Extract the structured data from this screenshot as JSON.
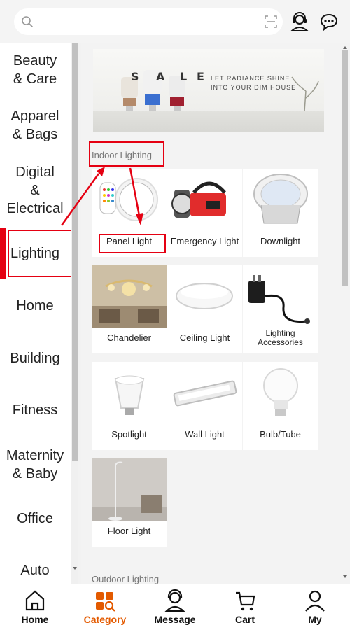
{
  "search": {
    "value": "",
    "placeholder": ""
  },
  "sidebar": {
    "items": [
      {
        "label": "Beauty\n& Care"
      },
      {
        "label": "Apparel\n& Bags"
      },
      {
        "label": "Digital\n&\nElectrical"
      },
      {
        "label": "Lighting"
      },
      {
        "label": "Home"
      },
      {
        "label": "Building"
      },
      {
        "label": "Fitness"
      },
      {
        "label": "Maternity\n& Baby"
      },
      {
        "label": "Office"
      },
      {
        "label": "Auto"
      }
    ],
    "active_index": 3
  },
  "banner": {
    "sale_letters": [
      "S",
      "A",
      "L",
      "E"
    ],
    "tagline": "LET RADIANCE SHINE INTO YOUR DIM HOUSE"
  },
  "sections": {
    "indoor_title": "Indoor Lighting",
    "outdoor_title": "Outdoor Lighting"
  },
  "products": [
    {
      "label": "Panel Light",
      "icon": "panel-light"
    },
    {
      "label": "Emergency Light",
      "icon": "emergency-light"
    },
    {
      "label": "Downlight",
      "icon": "downlight"
    },
    {
      "label": "Chandelier",
      "icon": "chandelier"
    },
    {
      "label": "Ceiling Light",
      "icon": "ceiling-light"
    },
    {
      "label": "Lighting Accessories",
      "icon": "lighting-accessories"
    },
    {
      "label": "Spotlight",
      "icon": "spotlight"
    },
    {
      "label": "Wall Light",
      "icon": "wall-light"
    },
    {
      "label": "Bulb/Tube",
      "icon": "bulb-tube"
    },
    {
      "label": "Floor Light",
      "icon": "floor-light"
    }
  ],
  "bottom_nav": [
    {
      "label": "Home",
      "icon": "home-icon"
    },
    {
      "label": "Category",
      "icon": "category-icon"
    },
    {
      "label": "Message",
      "icon": "message-icon"
    },
    {
      "label": "Cart",
      "icon": "cart-icon"
    },
    {
      "label": "My",
      "icon": "user-icon"
    }
  ],
  "colors": {
    "accent_red": "#e50012",
    "nav_active": "#e35a00",
    "annotation": "#e50012"
  }
}
